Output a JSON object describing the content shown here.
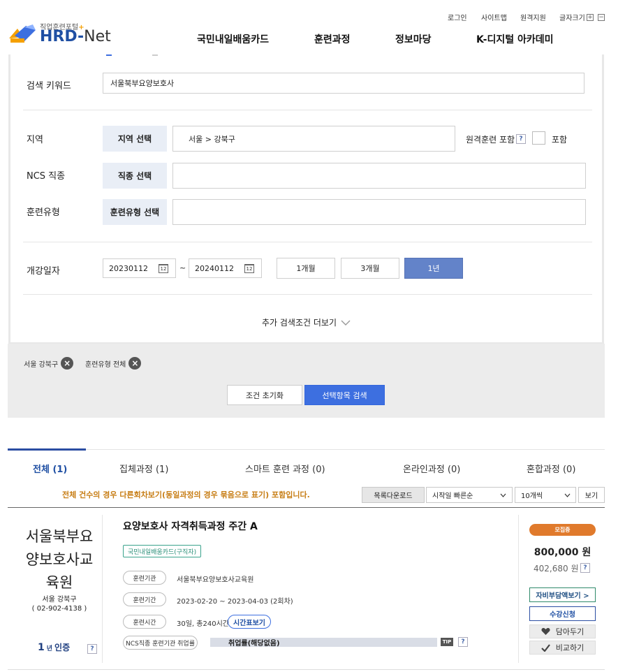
{
  "header": {
    "logo_sub": "직업훈련포털",
    "logo_plus": "+",
    "logo_main": "HRD-",
    "logo_net": "Net",
    "util": {
      "login": "로그인",
      "sitemap": "사이트맵",
      "remote": "원격지원",
      "fontsize": "글자크기",
      "plus": "+",
      "minus": "−"
    },
    "gnb": [
      "국민내일배움카드",
      "훈련과정",
      "정보마당",
      "K-디지털 아카데미"
    ]
  },
  "search": {
    "keyword_label": "검색 키워드",
    "keyword_value": "서울북부요양보호사",
    "region_label": "지역",
    "region_btn": "지역 선택",
    "region_value": "서울 > 강북구",
    "remote_label": "원격훈련 포함",
    "remote_q": "?",
    "include_label": "포함",
    "ncs_label": "NCS 직종",
    "ncs_btn": "직종 선택",
    "type_label": "훈련유형",
    "type_btn": "훈련유형 선택",
    "date_label": "개강일자",
    "date_from": "20230112",
    "date_to": "20240112",
    "date_tilde": "~",
    "cal_icon_text": "12",
    "periods": [
      "1개월",
      "3개월",
      "1년"
    ],
    "period_active": "1년",
    "more_label": "추가 검색조건 더보기"
  },
  "filters": {
    "tags": [
      "서울 강북구",
      "훈련유형 전체"
    ],
    "reset_label": "조건 초기화",
    "search_label": "선택항목 검색"
  },
  "tabs": [
    {
      "label": "전체 (1)",
      "active": true
    },
    {
      "label": "집체과정 (1)",
      "active": false
    },
    {
      "label": "스마트 훈련 과정 (0)",
      "active": false
    },
    {
      "label": "온라인과정 (0)",
      "active": false
    },
    {
      "label": "혼합과정 (0)",
      "active": false
    }
  ],
  "list_controls": {
    "notice": "전체 건수의 경우 다른회차보기(동일과정의 경우 묶음으로 표기) 포함입니다.",
    "download": "목록다운로드",
    "sort": "시작일 빠른순",
    "per_page": "10개씩",
    "view": "보기"
  },
  "course": {
    "institution_lines": [
      "서울북부요",
      "양보호사교",
      "육원"
    ],
    "location": "서울 강북구",
    "phone": "( 02-902-4138 )",
    "cert_num": "1",
    "cert_unit": "년",
    "cert_label": "인증",
    "cert_q": "?",
    "title": "요양보호사 자격취득과정 주간 A",
    "card_badge": "국민내일배움카드(구직자)",
    "inst_pill": "훈련기관",
    "inst_value": "서울북부요양보호사교육원",
    "period_pill": "훈련기간",
    "period_value": "2023-02-20 ~ 2023-04-03 (2회차)",
    "time_pill": "훈련시간",
    "time_value": "30일, 총240시간",
    "timetable_btn": "시간표보기",
    "ncs_pill": "NCS직종 훈련기관 취업률",
    "employment": "취업률(해당없음)",
    "tip": "TIP",
    "tip_q": "?",
    "status": "모집중",
    "price": "800,000 원",
    "self_pay": "402,680 원",
    "price_q": "?",
    "self_pay_btn": "자비부담액보기 >",
    "apply_btn": "수강신청",
    "wishlist": "담아두기",
    "compare": "비교하기"
  }
}
